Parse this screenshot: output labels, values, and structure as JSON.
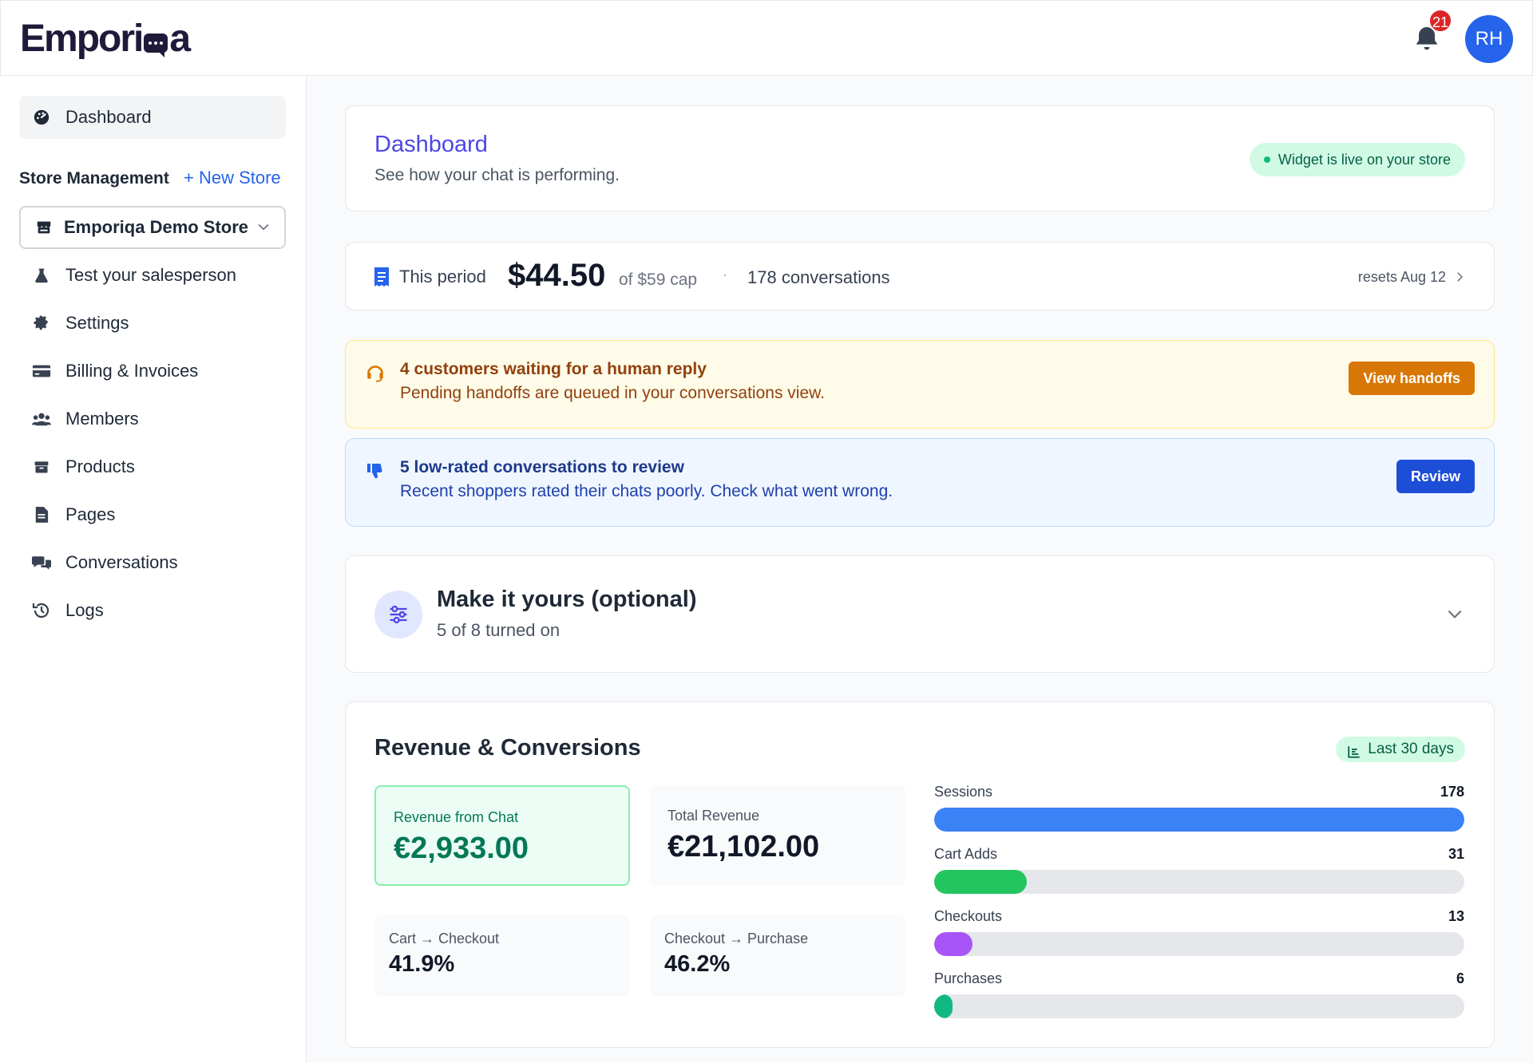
{
  "header": {
    "logo_text_1": "Empori",
    "logo_text_2": "a",
    "notification_count": "21",
    "avatar_initials": "RH"
  },
  "sidebar": {
    "dashboard_label": "Dashboard",
    "store_management_label": "Store Management",
    "new_store_label": "+ New Store",
    "store_select_value": "Emporiqa Demo Store",
    "items": [
      {
        "label": "Test your salesperson",
        "icon": "flask-icon"
      },
      {
        "label": "Settings",
        "icon": "gear-icon"
      },
      {
        "label": "Billing & Invoices",
        "icon": "credit-card-icon"
      },
      {
        "label": "Members",
        "icon": "users-icon"
      },
      {
        "label": "Products",
        "icon": "box-icon"
      },
      {
        "label": "Pages",
        "icon": "document-icon"
      },
      {
        "label": "Conversations",
        "icon": "chat-bubbles-icon"
      },
      {
        "label": "Logs",
        "icon": "history-icon"
      }
    ]
  },
  "dashboard_header": {
    "title": "Dashboard",
    "subtitle": "See how your chat is performing.",
    "status_pill": "Widget is live on your store"
  },
  "usage": {
    "period_label": "This period",
    "amount": "$44.50",
    "cap": "of $59 cap",
    "separator": "·",
    "conversations": "178 conversations",
    "resets": "resets Aug 12"
  },
  "alerts": {
    "handoff": {
      "title": "4 customers waiting for a human reply",
      "body": "Pending handoffs are queued in your conversations view.",
      "button": "View handoffs"
    },
    "review": {
      "title": "5 low-rated conversations to review",
      "body": "Recent shoppers rated their chats poorly. Check what went wrong.",
      "button": "Review"
    }
  },
  "customize": {
    "title": "Make it yours (optional)",
    "subtitle": "5 of 8 turned on"
  },
  "revenue": {
    "title": "Revenue & Conversions",
    "range_pill": "Last 30 days",
    "revenue_from_chat_label": "Revenue from Chat",
    "revenue_from_chat_value": "€2,933.00",
    "total_revenue_label": "Total Revenue",
    "total_revenue_value": "€21,102.00",
    "cart_checkout_label": "Cart → Checkout",
    "cart_checkout_value": "41.9%",
    "checkout_purchase_label": "Checkout → Purchase",
    "checkout_purchase_value": "46.2%",
    "funnel": [
      {
        "name": "Sessions",
        "value": "178",
        "fraction": 1.0,
        "color": "#3b82f6"
      },
      {
        "name": "Cart Adds",
        "value": "31",
        "fraction": 0.174,
        "color": "#22c55e"
      },
      {
        "name": "Checkouts",
        "value": "13",
        "fraction": 0.073,
        "color": "#a855f7"
      },
      {
        "name": "Purchases",
        "value": "6",
        "fraction": 0.034,
        "color": "#10b981"
      }
    ]
  },
  "colors": {
    "accent": "#4f46e5",
    "link": "#2563eb",
    "handoff_bg": "#fefce8",
    "handoff_button": "#d97706",
    "review_bg": "#eff6ff",
    "review_button": "#1d4ed8"
  }
}
